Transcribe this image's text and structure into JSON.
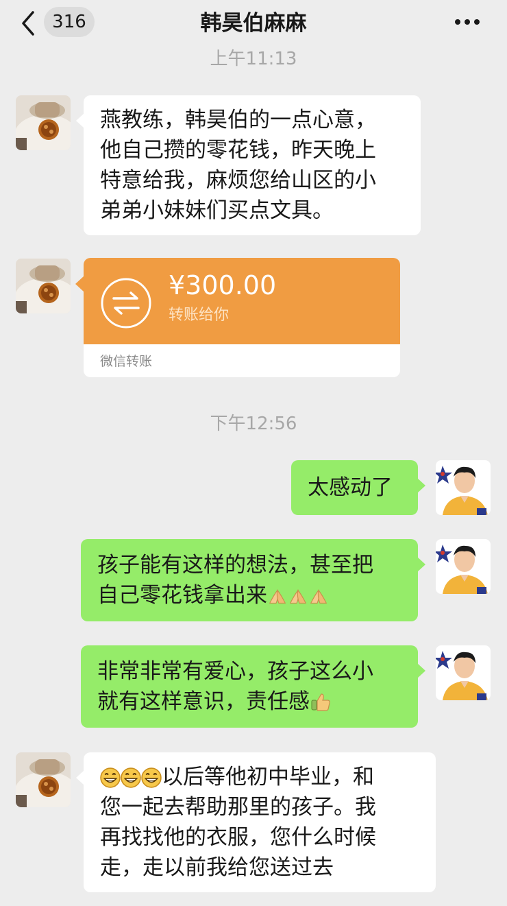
{
  "header": {
    "back_icon": "chevron-left-icon",
    "unread_count": "316",
    "title": "韩昊伯麻麻",
    "more_icon": "more-dots-icon"
  },
  "timestamps": [
    "上午11:13",
    "下午12:56"
  ],
  "messages": [
    {
      "side": "in",
      "lines": [
        "燕教练，韩昊伯的一点心意，",
        "他自己攒的零花钱，昨天晚上",
        "特意给我，麻烦您给山区的小",
        "弟弟小妹妹们买点文具。"
      ]
    },
    {
      "side": "in",
      "type": "transfer",
      "amount": "¥300.00",
      "label": "转账给你",
      "footer": "微信转账",
      "color": "#f09c42"
    },
    {
      "side": "out",
      "lines": [
        "太感动了"
      ]
    },
    {
      "side": "out",
      "lines": [
        "孩子能有这样的想法，甚至把",
        "自己零花钱拿出来"
      ],
      "emoji": [
        "folded-hands-icon",
        "folded-hands-icon",
        "folded-hands-icon"
      ]
    },
    {
      "side": "out",
      "lines": [
        "非常非常有爱心，孩子这么小",
        "就有这样意识，责任感"
      ],
      "emoji": [
        "thumbs-up-icon"
      ]
    },
    {
      "side": "in",
      "lines": [
        "以后等他初中毕业，和",
        "您一起去帮助那里的孩子。我",
        "再找找他的衣服，您什么时候",
        "走，走以前我给您送过去"
      ],
      "emoji": [
        "grinning-face-icon",
        "grinning-face-icon",
        "grinning-face-icon"
      ]
    }
  ],
  "colors": {
    "background": "#ededed",
    "incoming_bubble": "#ffffff",
    "outgoing_bubble": "#95ec69",
    "transfer": "#f09c42"
  }
}
